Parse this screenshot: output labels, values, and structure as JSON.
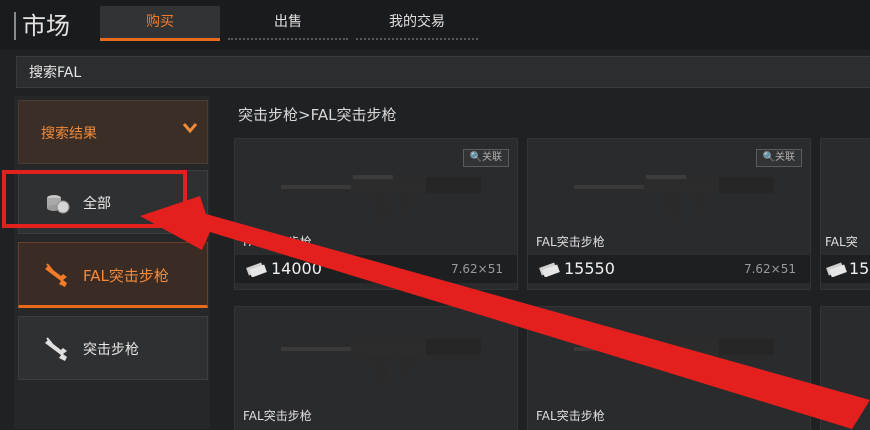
{
  "header": {
    "title": "市场"
  },
  "tabs": [
    {
      "label": "购买",
      "active": true
    },
    {
      "label": "出售",
      "active": false
    },
    {
      "label": "我的交易",
      "active": false
    }
  ],
  "search": {
    "value": "搜索FAL"
  },
  "sidebar": {
    "filter_label": "搜索结果",
    "items": [
      {
        "label": "全部",
        "icon": "coins-icon"
      },
      {
        "label": "FAL突击步枪",
        "icon": "rifle-icon",
        "active": true
      },
      {
        "label": "突击步枪",
        "icon": "rifle-icon"
      }
    ]
  },
  "breadcrumb": "突击步枪>FAL突击步枪",
  "cards": [
    {
      "name": "FAL突击步枪",
      "price": "14000",
      "caliber": "7.62×51",
      "link": "关联"
    },
    {
      "name": "FAL突击步枪",
      "price": "15550",
      "caliber": "7.62×51",
      "link": "关联"
    },
    {
      "name": "FAL突",
      "price": "15",
      "caliber": "",
      "link": ""
    },
    {
      "name": "FAL突击步枪",
      "price": "",
      "caliber": "",
      "link": ""
    },
    {
      "name": "FAL突击步枪",
      "price": "",
      "caliber": "",
      "link": ""
    },
    {
      "name": "FAL突",
      "price": "",
      "caliber": "",
      "link": ""
    }
  ],
  "colors": {
    "accent": "#e86a1c",
    "annotation": "#e3201d"
  }
}
